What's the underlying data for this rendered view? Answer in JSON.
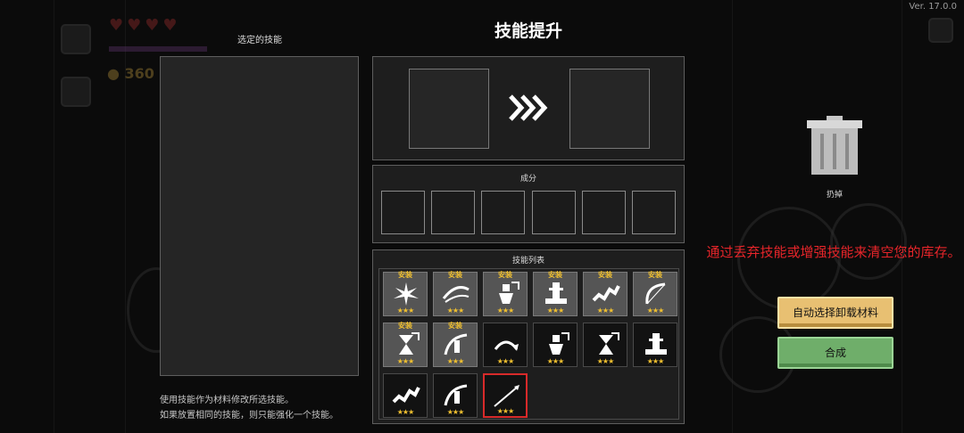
{
  "version": "Ver. 17.0.0",
  "title": "技能提升",
  "selected_panel": {
    "title": "选定的技能",
    "hint_lines": [
      "使用技能作为材料修改所选技能。",
      "如果放置相同的技能，则只能强化一个技能。"
    ]
  },
  "ingredients": {
    "title": "成分"
  },
  "skill_list": {
    "title": "技能列表",
    "items": [
      {
        "tag": "安装",
        "stars": "★★★",
        "icon": "spark-burst-icon"
      },
      {
        "tag": "安装",
        "stars": "★★★",
        "icon": "swoosh-icon"
      },
      {
        "tag": "安装",
        "stars": "★★★",
        "icon": "figure-arrow-icon"
      },
      {
        "tag": "安装",
        "stars": "★★★",
        "icon": "totem-icon"
      },
      {
        "tag": "安装",
        "stars": "★★★",
        "icon": "chain-icon"
      },
      {
        "tag": "安装",
        "stars": "★★★",
        "icon": "bow-slash-icon"
      },
      {
        "tag": "安装",
        "stars": "★★★",
        "icon": "hourglass-arrow-icon"
      },
      {
        "tag": "安装",
        "stars": "★★★",
        "icon": "bow-figure-icon"
      },
      {
        "tag": "",
        "stars": "★★★",
        "icon": "arc-arrow-icon"
      },
      {
        "tag": "",
        "stars": "★★★",
        "icon": "figure-arrow-icon"
      },
      {
        "tag": "",
        "stars": "★★★",
        "icon": "hourglass-arrow-icon"
      },
      {
        "tag": "",
        "stars": "★★★",
        "icon": "totem-icon"
      },
      {
        "tag": "",
        "stars": "★★★",
        "icon": "chain-icon"
      },
      {
        "tag": "",
        "stars": "★★★",
        "icon": "bow-figure-icon"
      },
      {
        "tag": "",
        "stars": "★★★",
        "icon": "spear-icon"
      }
    ]
  },
  "trash": {
    "label": "扔掉"
  },
  "warning": "通过丢弃技能或增强技能来清空您的库存。",
  "buttons": {
    "auto_select": "自动选择卸载材料",
    "merge": "合成"
  },
  "hud": {
    "coins": "360"
  },
  "colors": {
    "accent_gold": "#f0c030",
    "warning_red": "#e8252a",
    "merge_green": "#6fae6a",
    "auto_gold": "#e8c072"
  }
}
